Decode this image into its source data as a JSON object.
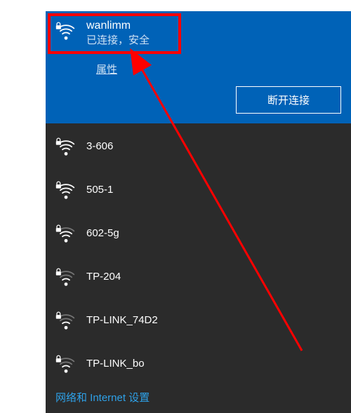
{
  "connected": {
    "ssid": "wanlimm",
    "status": "已连接，安全",
    "properties_label": "属性",
    "disconnect_label": "断开连接",
    "secured": true,
    "signal": 4
  },
  "networks": [
    {
      "ssid": "3-606",
      "secured": true,
      "signal": 4
    },
    {
      "ssid": "505-1",
      "secured": true,
      "signal": 4
    },
    {
      "ssid": "602-5g",
      "secured": true,
      "signal": 3
    },
    {
      "ssid": "TP-204",
      "secured": true,
      "signal": 2
    },
    {
      "ssid": "TP-LINK_74D2",
      "secured": true,
      "signal": 2
    },
    {
      "ssid": "TP-LINK_bo",
      "secured": true,
      "signal": 2
    }
  ],
  "footer": {
    "settings_label": "网络和 Internet 设置"
  },
  "icon_colors": {
    "fg": "#ffffff"
  }
}
